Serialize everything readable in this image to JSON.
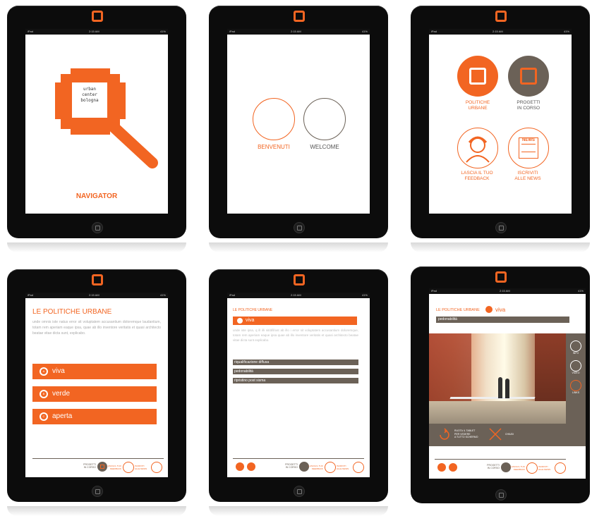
{
  "status": {
    "carrier": "iPad",
    "time": "2:15 AM",
    "battery": "41%"
  },
  "t1": {
    "logo_lines": [
      "urban",
      "center",
      "bologna"
    ],
    "title": "NAVIGATOR"
  },
  "t2": {
    "left": "BENVENUTI",
    "right": "WELCOME"
  },
  "t3": {
    "items": [
      {
        "l1": "POLITICHE",
        "l2": "URBANE"
      },
      {
        "l1": "PROGETTI",
        "l2": "IN CORSO"
      },
      {
        "l1": "LASCIA IL TUO",
        "l2": "FEEDBACK"
      },
      {
        "l1": "ISCRIVITI",
        "l2": "ALLE NEWS"
      }
    ],
    "news_icon": "NEWS"
  },
  "t4": {
    "title": "LE POLITICHE URBANE",
    "body": "unde omnis iste natus error sit voluptatem accusantium doloremque laudantium, totam rem aperiam eaque ipsa, quae ab illo inventore veritatis et quasi architecto beatae vitae dicta sunt, explicabo.",
    "buttons": [
      {
        "letter": "A",
        "label": "viva"
      },
      {
        "letter": "B",
        "label": "verde"
      },
      {
        "letter": "C",
        "label": "aperta"
      }
    ],
    "footer": {
      "projects": [
        "PROGETTI",
        "IN CORSO"
      ],
      "feedback": [
        "LASCIA IL TUO",
        "FEEDBACK"
      ],
      "news": [
        "ISCRIVITI",
        "ALLE NEWS"
      ]
    }
  },
  "t5": {
    "crumb": "LE POLITICHE URBANE",
    "selected": "viva",
    "body": "unde iste ipsa, q ill illi sit/d/ll/ust ab illo i error sit voluptatem accusantium doloremque, totam rem aperiam eaque ipsa quae ab illo inventore veritatis et quasi architecto beatae vitae dicta sunt explicabo.",
    "items": [
      "riqualificazione diffusa",
      "pedonabilità",
      "ripristino post sisma"
    ]
  },
  "t6": {
    "crumb": "LE POLITICHE URBANE",
    "selected": "viva",
    "bar": "pedonabilità",
    "side": [
      "INFO",
      "VIDEO",
      "LINKS"
    ],
    "rotate": [
      "RUOTA IL TABLET",
      "PER VEDERE",
      "A TUTTO SCHERMO"
    ],
    "close": "CHIUDI"
  },
  "colors": {
    "accent": "#f26522",
    "brown": "#6b6157",
    "dark": "#0c0c0c"
  }
}
